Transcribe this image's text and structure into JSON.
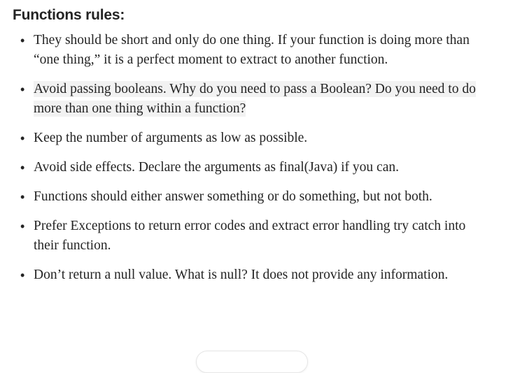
{
  "heading": "Functions rules:",
  "rules": [
    {
      "text": "They should be short and only do one thing. If your function is doing more than “one thing,” it is a perfect moment to extract to another function.",
      "highlighted": false
    },
    {
      "text": "Avoid passing booleans. Why do you need to pass a Boolean? Do you need to do more than one thing within a function?",
      "highlighted": true
    },
    {
      "text": "Keep the number of arguments as low as possible.",
      "highlighted": false
    },
    {
      "text": "Avoid side effects. Declare the arguments as final(Java) if you can.",
      "highlighted": false
    },
    {
      "text": "Functions should either answer something or do something, but not both.",
      "highlighted": false
    },
    {
      "text": "Prefer Exceptions to return error codes and extract error handling try catch into their function.",
      "highlighted": false
    },
    {
      "text": "Don’t return a null value. What is null? It does not provide any information.",
      "highlighted": false
    }
  ],
  "colors": {
    "text": "#242424",
    "highlight": "#f2f2f2",
    "background": "#ffffff"
  }
}
